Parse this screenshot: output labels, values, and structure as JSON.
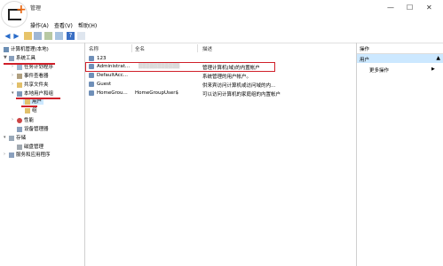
{
  "window": {
    "title": "管理"
  },
  "menu": [
    "操作(A)",
    "查看(V)",
    "帮助(H)"
  ],
  "tree": {
    "root": "计算机管理(本地)",
    "system_tools": "系统工具",
    "task_scheduler": "任务计划程序",
    "event_viewer": "事件查看器",
    "shared_folders": "共享文件夹",
    "local_users": "本地用户和组",
    "users": "用户",
    "groups": "组",
    "performance": "性能",
    "device_manager": "设备管理器",
    "storage": "存储",
    "disk_mgmt": "磁盘管理",
    "services": "服务和应用程序"
  },
  "columns": [
    "名称",
    "全名",
    "描述"
  ],
  "rows": [
    {
      "name": "123",
      "full": "",
      "desc": ""
    },
    {
      "name": "Administrat...",
      "full": "",
      "desc": "管理计算机(域)的内置帐户"
    },
    {
      "name": "DefaultAcc...",
      "full": "",
      "desc": "系统管理的用户帐户。"
    },
    {
      "name": "Guest",
      "full": "",
      "desc": "供来宾访问计算机或访问域的内..."
    },
    {
      "name": "HomeGrou...",
      "full": "HomeGroupUser$",
      "desc": "可以访问计算机的家庭组的内置帐户"
    }
  ],
  "actions": {
    "header": "操作",
    "section": "用户",
    "more": "更多操作"
  },
  "colors": {
    "annotation": "#d0202a",
    "selection": "#cce8ff"
  }
}
